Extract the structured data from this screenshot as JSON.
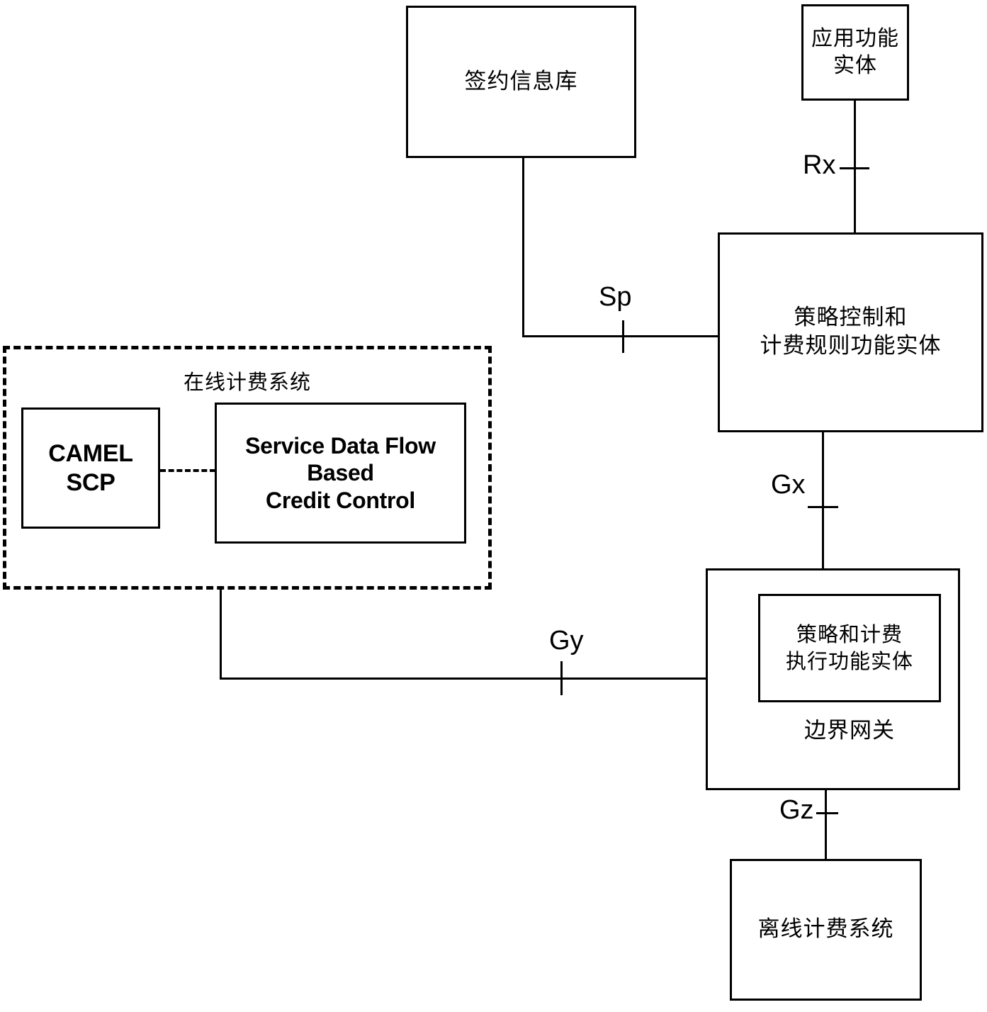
{
  "diagram": {
    "title": "PCC architecture diagram",
    "nodes": {
      "subscription_db": "签约信息库",
      "application_function": "应用功能\n实体",
      "pcrf": "策略控制和\n计费规则功能实体",
      "ocs_title": "在线计费系统",
      "camel_scp": "CAMEL\nSCP",
      "sdf_credit_control": "Service Data Flow\nBased\nCredit Control",
      "pcef": "策略和计费\n执行功能实体",
      "border_gateway": "边界网关",
      "offline_charging": "离线计费系统"
    },
    "interfaces": {
      "rx": "Rx",
      "sp": "Sp",
      "gx": "Gx",
      "gy": "Gy",
      "gz": "Gz"
    },
    "colors": {
      "stroke": "#000000",
      "background": "#ffffff"
    }
  }
}
